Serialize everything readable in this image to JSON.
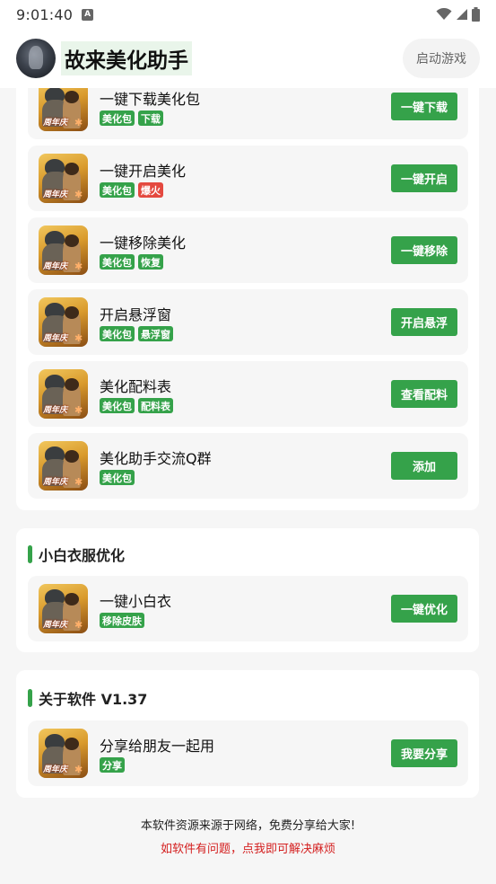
{
  "status": {
    "time": "9:01:40",
    "a_icon": "A"
  },
  "header": {
    "title": "故来美化助手",
    "launch_label": "启动游戏"
  },
  "beautify_list": [
    {
      "title": "一键下载美化包",
      "badges": [
        {
          "text": "美化包",
          "color": "green"
        },
        {
          "text": "下载",
          "color": "green"
        }
      ],
      "button": "一键下载"
    },
    {
      "title": "一键开启美化",
      "badges": [
        {
          "text": "美化包",
          "color": "green"
        },
        {
          "text": "爆火",
          "color": "red"
        }
      ],
      "button": "一键开启"
    },
    {
      "title": "一键移除美化",
      "badges": [
        {
          "text": "美化包",
          "color": "green"
        },
        {
          "text": "恢复",
          "color": "green"
        }
      ],
      "button": "一键移除"
    },
    {
      "title": "开启悬浮窗",
      "badges": [
        {
          "text": "美化包",
          "color": "green"
        },
        {
          "text": "悬浮窗",
          "color": "green"
        }
      ],
      "button": "开启悬浮"
    },
    {
      "title": "美化配料表",
      "badges": [
        {
          "text": "美化包",
          "color": "green"
        },
        {
          "text": "配料表",
          "color": "green"
        }
      ],
      "button": "查看配料"
    },
    {
      "title": "美化助手交流Q群",
      "badges": [
        {
          "text": "美化包",
          "color": "green"
        }
      ],
      "button": "添加"
    }
  ],
  "section_white": {
    "title": "小白衣服优化",
    "items": [
      {
        "title": "一键小白衣",
        "badges": [
          {
            "text": "移除皮肤",
            "color": "green"
          }
        ],
        "button": "一键优化"
      }
    ]
  },
  "section_about": {
    "title": "关于软件 V1.37",
    "items": [
      {
        "title": "分享给朋友一起用",
        "badges": [
          {
            "text": "分享",
            "color": "green"
          }
        ],
        "button": "我要分享"
      }
    ]
  },
  "thumb_label": "周年庆",
  "footer": {
    "line1": "本软件资源来源于网络，免费分享给大家!",
    "line2": "如软件有问题，点我即可解决麻烦"
  },
  "colors": {
    "accent_green": "#35a24a",
    "badge_red": "#e4493f",
    "footer_red": "#d42020"
  }
}
